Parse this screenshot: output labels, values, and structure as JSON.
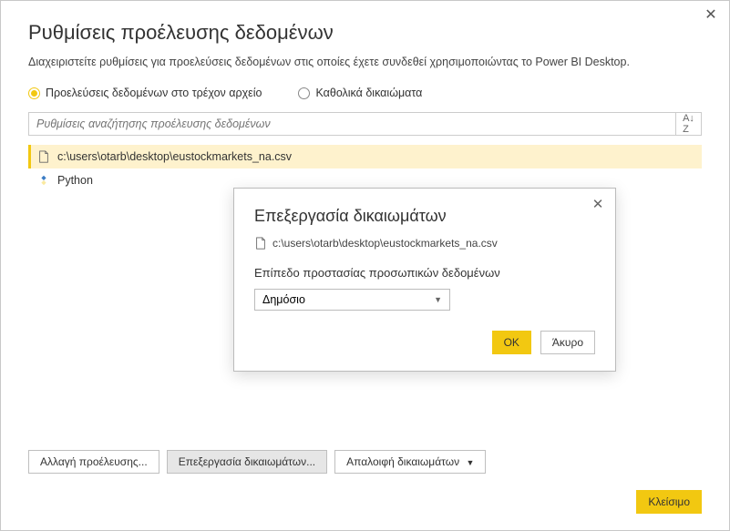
{
  "window": {
    "title": "Ρυθμίσεις προέλευσης δεδομένων",
    "subtitle": "Διαχειριστείτε ρυθμίσεις για προελεύσεις δεδομένων στις οποίες έχετε συνδεθεί χρησιμοποιώντας το Power BI Desktop."
  },
  "radios": {
    "current_file": "Προελεύσεις δεδομένων στο τρέχον αρχείο",
    "global": "Καθολικά δικαιώματα"
  },
  "search": {
    "placeholder": "Ρυθμίσεις αναζήτησης προέλευσης δεδομένων"
  },
  "list": [
    {
      "label": "c:\\users\\otarb\\desktop\\eustockmarkets_na.csv",
      "icon": "file"
    },
    {
      "label": "Python",
      "icon": "python"
    }
  ],
  "buttons": {
    "change_source": "Αλλαγή προέλευσης...",
    "edit_permissions": "Επεξεργασία δικαιωμάτων...",
    "clear_permissions": "Απαλοιφή δικαιωμάτων",
    "close": "Κλείσιμο"
  },
  "modal": {
    "title": "Επεξεργασία δικαιωμάτων",
    "path": "c:\\users\\otarb\\desktop\\eustockmarkets_na.csv",
    "privacy_label": "Επίπεδο προστασίας προσωπικών δεδομένων",
    "privacy_value": "Δημόσιο",
    "ok": "OK",
    "cancel": "Άκυρο"
  }
}
